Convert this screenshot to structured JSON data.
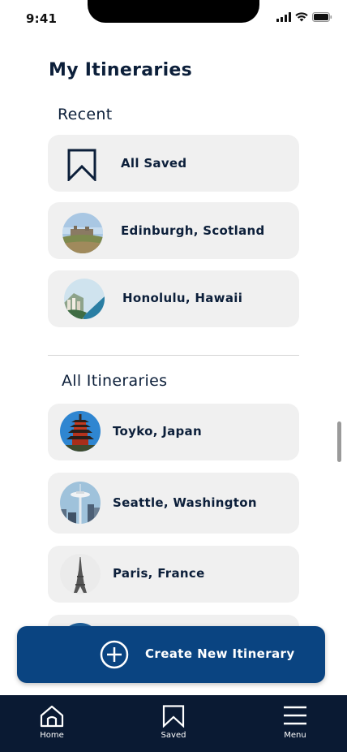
{
  "status_bar": {
    "time": "9:41"
  },
  "title": "My Itineraries",
  "recent": {
    "heading": "Recent",
    "items": [
      {
        "label": "All Saved",
        "icon": "bookmark-icon"
      },
      {
        "label": "Edinburgh, Scotland",
        "icon": "edinburgh-photo"
      },
      {
        "label": "Honolulu, Hawaii",
        "icon": "honolulu-photo"
      }
    ]
  },
  "all": {
    "heading": "All Itineraries",
    "items": [
      {
        "label": "Toyko, Japan",
        "icon": "tokyo-photo"
      },
      {
        "label": "Seattle, Washington",
        "icon": "seattle-photo"
      },
      {
        "label": "Paris, France",
        "icon": "paris-photo"
      }
    ]
  },
  "cta": {
    "label": "Create New Itinerary",
    "icon": "plus-circle-icon"
  },
  "nav": {
    "items": [
      {
        "label": "Home",
        "icon": "home-icon"
      },
      {
        "label": "Saved",
        "icon": "bookmark-icon"
      },
      {
        "label": "Menu",
        "icon": "menu-icon"
      }
    ]
  },
  "colors": {
    "primary": "#0a4481",
    "nav_background": "#0a1a33",
    "card_background": "#f0f0f0",
    "text": "#0c1f3a"
  }
}
